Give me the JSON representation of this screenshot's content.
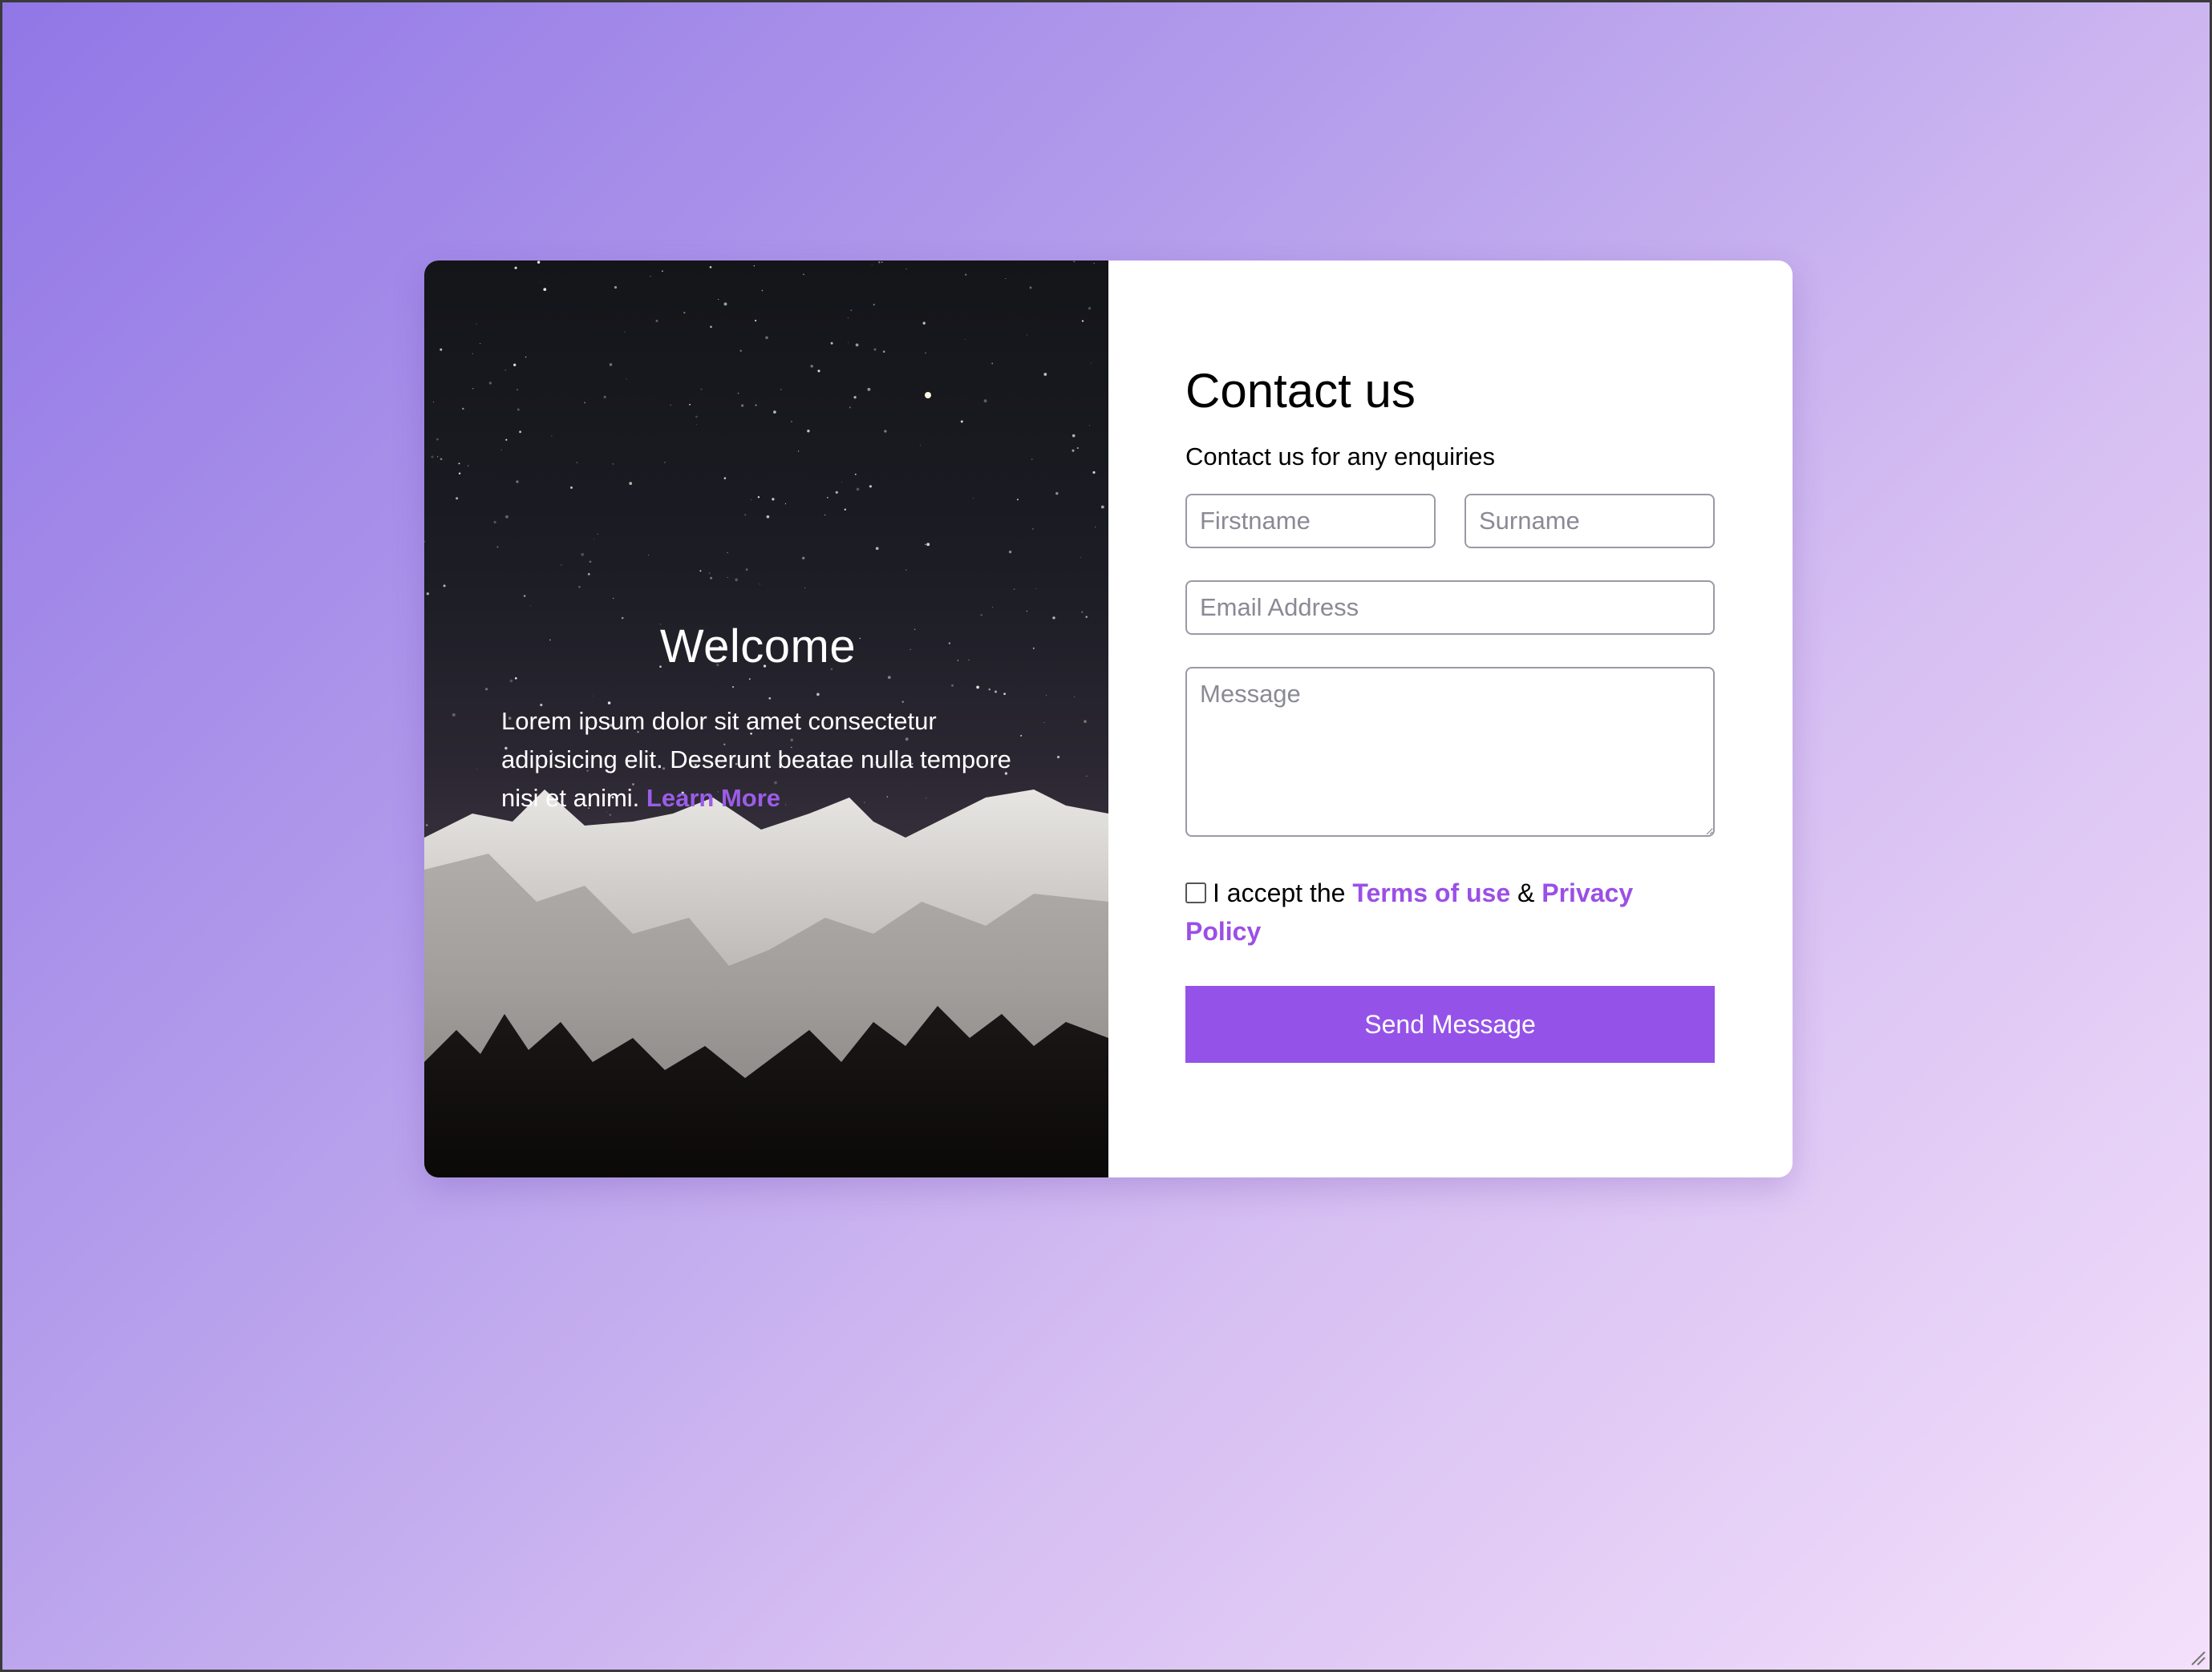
{
  "colors": {
    "accent": "#9552e8",
    "link": "#9b4fe6",
    "background_start": "#9177e6",
    "background_end": "#f4e0fb"
  },
  "hero": {
    "image": "starry-mountain-night-photo",
    "title": "Welcome",
    "body": "Lorem ipsum dolor sit amet consectetur adipisicing elit. Deserunt beatae nulla tempore nisi et animi.",
    "link_label": "Learn More"
  },
  "form": {
    "title": "Contact us",
    "subtitle": "Contact us for any enquiries",
    "firstname_placeholder": "Firstname",
    "surname_placeholder": "Surname",
    "email_placeholder": "Email Address",
    "message_placeholder": "Message",
    "consent_prefix": "I accept the",
    "terms_label": "Terms of use",
    "consent_joiner": "&",
    "privacy_label": "Privacy Policy",
    "checkbox_checked": false,
    "submit_label": "Send Message"
  }
}
